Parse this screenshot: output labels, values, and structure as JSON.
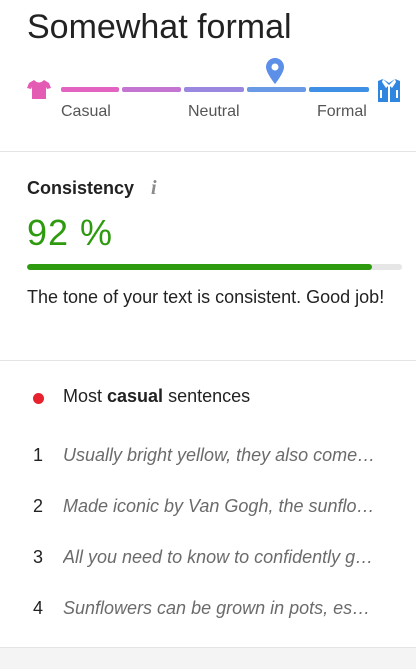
{
  "tone": {
    "title": "Somewhat formal",
    "scale_labels": {
      "left": "Casual",
      "center": "Neutral",
      "right": "Formal"
    },
    "marker_position": 0.68,
    "colors": {
      "casual": "#e45bb4",
      "formal": "#2e86e0"
    },
    "icons": {
      "left": "casual-shirt-icon",
      "right": "formal-shirt-icon",
      "marker": "location-pin-icon"
    }
  },
  "consistency": {
    "title": "Consistency",
    "info_icon": "info-icon",
    "percent": "92 %",
    "value": 0.92,
    "message": "The tone of your text is consistent. Good job!",
    "color": "#2e9a0f"
  },
  "casual_sentences": {
    "heading_prefix": "Most ",
    "heading_emphasis": "casual",
    "heading_suffix": " sentences",
    "dot_color": "#e8212e",
    "items": [
      {
        "num": "1",
        "text": "Usually bright yellow, they also come…"
      },
      {
        "num": "2",
        "text": "Made iconic by Van Gogh, the sunflo…"
      },
      {
        "num": "3",
        "text": "All you need to know to confidently g…"
      },
      {
        "num": "4",
        "text": "Sunflowers can be grown in pots, es…"
      }
    ]
  }
}
